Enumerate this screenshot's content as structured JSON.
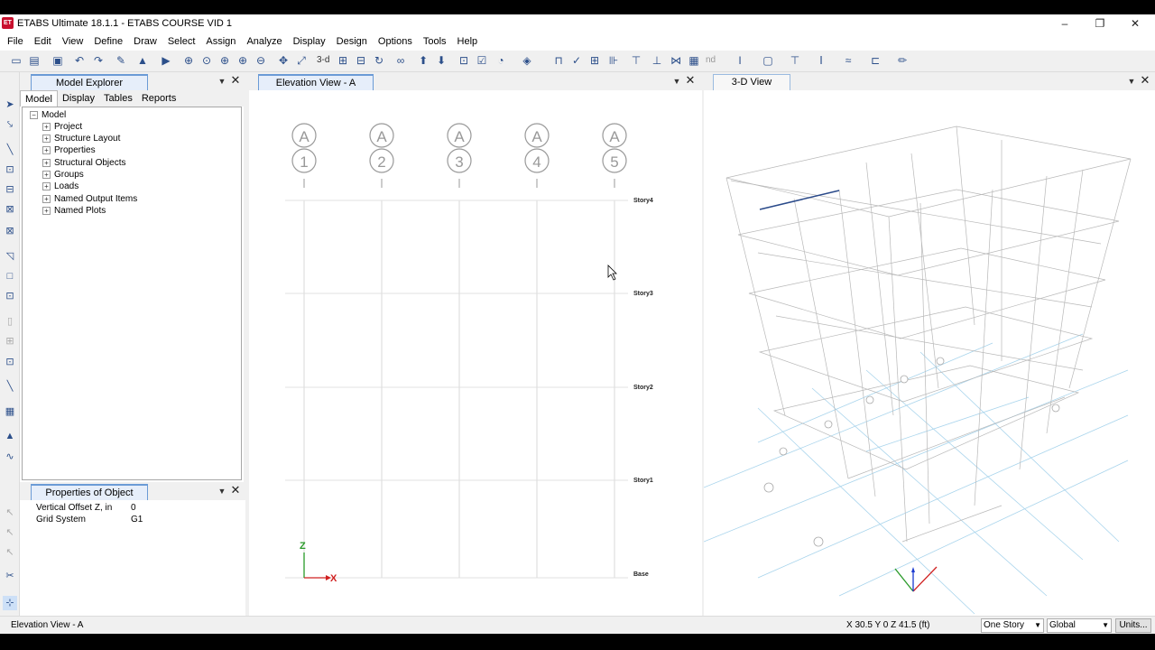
{
  "window": {
    "logo": "ET",
    "title": "ETABS Ultimate 18.1.1 - ETABS COURSE VID 1",
    "minimize": "–",
    "restore": "❐",
    "close": "✕"
  },
  "menu": [
    "File",
    "Edit",
    "View",
    "Define",
    "Draw",
    "Select",
    "Assign",
    "Analyze",
    "Display",
    "Design",
    "Options",
    "Tools",
    "Help"
  ],
  "toolbar": {
    "view_3d": "3-d",
    "view_nd": "nd"
  },
  "model_explorer": {
    "title": "Model Explorer",
    "tabs": [
      "Model",
      "Display",
      "Tables",
      "Reports"
    ],
    "root": "Model",
    "items": [
      "Project",
      "Structure Layout",
      "Properties",
      "Structural Objects",
      "Groups",
      "Loads",
      "Named Output Items",
      "Named Plots"
    ]
  },
  "properties": {
    "title": "Properties of Object",
    "rows": [
      {
        "label": "Vertical Offset Z, in",
        "value": "0"
      },
      {
        "label": "Grid System",
        "value": "G1"
      }
    ]
  },
  "elevation_view": {
    "title": "Elevation View - A",
    "grid_top_label": "A",
    "grid_bubbles": [
      "1",
      "2",
      "3",
      "4",
      "5"
    ],
    "stories": [
      "Story4",
      "Story3",
      "Story2",
      "Story1",
      "Base"
    ],
    "axis_z": "Z",
    "axis_x": "X"
  },
  "threed_view": {
    "title": "3-D View"
  },
  "status": {
    "view_name": "Elevation View - A",
    "coords": "X 30.5  Y 0  Z 41.5 (ft)",
    "story_mode": "One Story",
    "coord_system": "Global",
    "units_button": "Units..."
  },
  "colors": {
    "accent": "#6b9bd6",
    "axis_green": "#2a9a2a",
    "axis_red": "#d02020",
    "axis_blue": "#1a3ad0"
  }
}
